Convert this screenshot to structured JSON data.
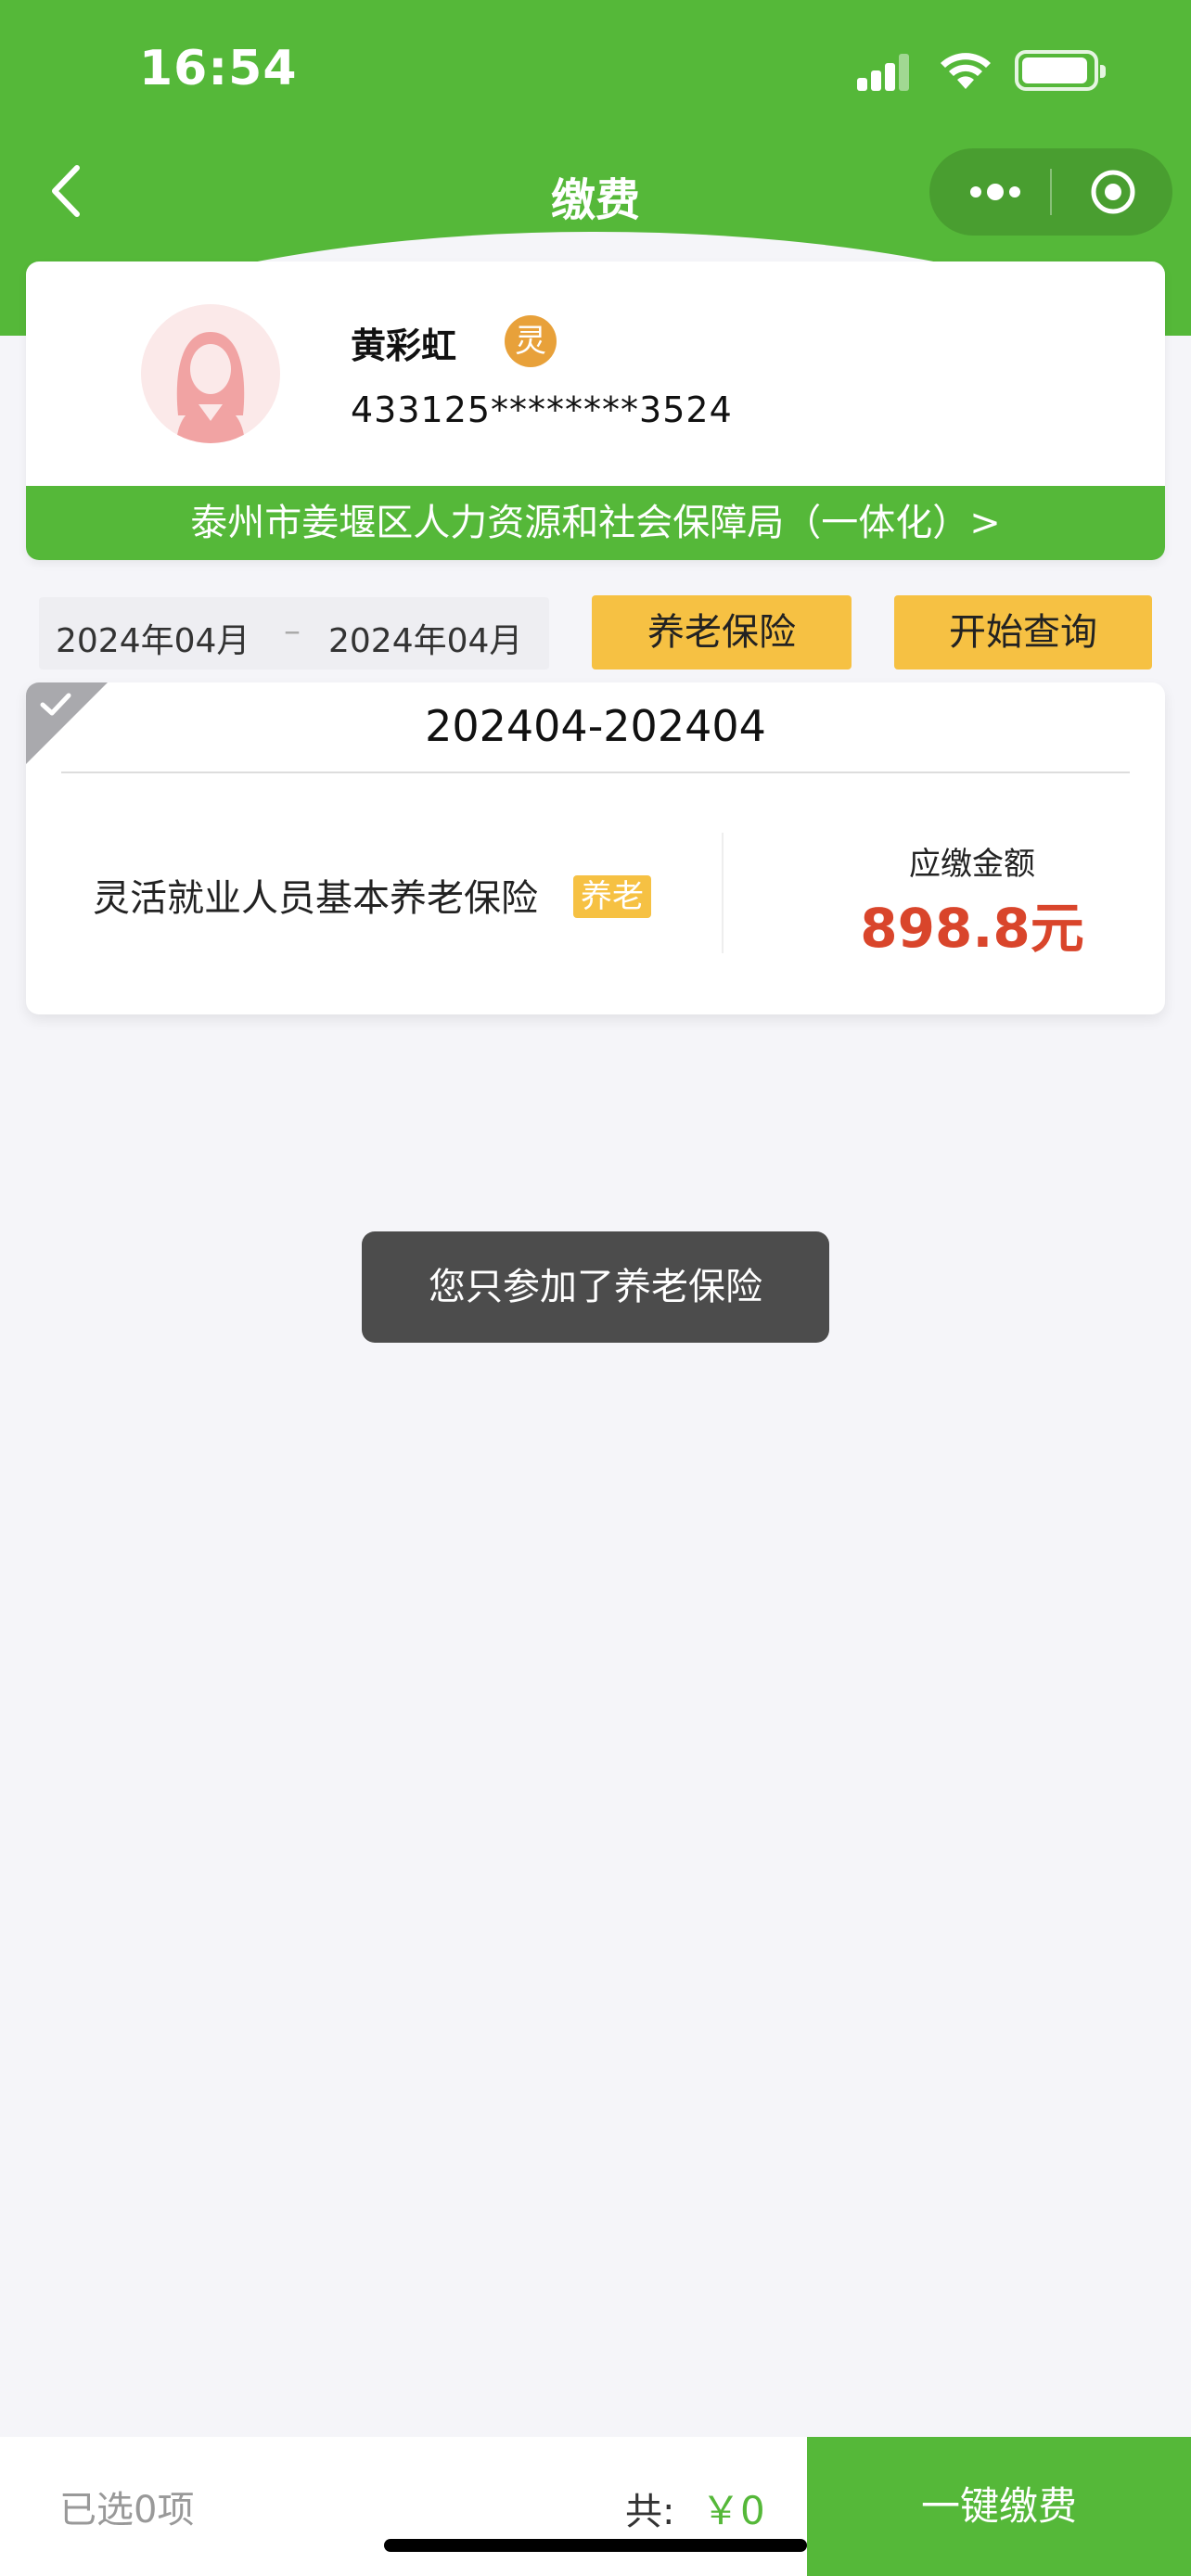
{
  "status_bar": {
    "time": "16:54"
  },
  "nav": {
    "title": "缴费"
  },
  "profile": {
    "name": "黄彩虹",
    "badge": "灵",
    "id_number": "433125********3524",
    "agency": "泰州市姜堰区人力资源和社会保障局（一体化）>"
  },
  "query": {
    "start_date": "2024年04月",
    "separator": "–",
    "end_date": "2024年04月",
    "insurance_type": "养老保险",
    "query_button": "开始查询"
  },
  "payment": {
    "period": "202404-202404",
    "insurance_name": "灵活就业人员基本养老保险",
    "tag": "养老",
    "due_label": "应缴金额",
    "due_amount": "898.8元",
    "selected": true
  },
  "toast": {
    "message": "您只参加了养老保险"
  },
  "bottom": {
    "selected_count": "已选0项",
    "total_label": "共:",
    "total_amount": "￥0",
    "pay_button": "一键缴费"
  },
  "colors": {
    "primary_green": "#55b839",
    "accent_yellow": "#f6c143",
    "amount_red": "#d9452b",
    "badge_orange": "#e8a13a"
  }
}
